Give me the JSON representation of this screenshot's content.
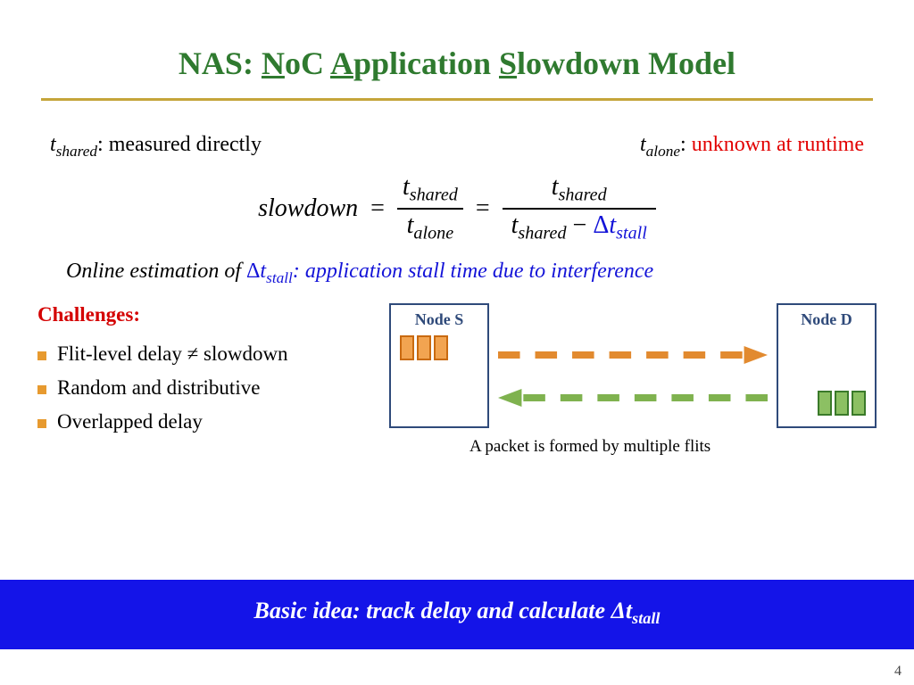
{
  "title": {
    "prefix": "NAS: ",
    "n": "N",
    "oc": "oC ",
    "a": "A",
    "pp": "pplication ",
    "s": "S",
    "rest": "lowdown Model"
  },
  "defs": {
    "left_pre": "t",
    "left_sub": "shared",
    "left_colon": ": ",
    "left_txt": "measured directly",
    "right_pre": "t",
    "right_sub": "alone",
    "right_colon": ": ",
    "right_txt": "unknown at runtime"
  },
  "eq": {
    "slowdown": "slowdown",
    "eq": "=",
    "f1_num_t": "t",
    "f1_num_sub": "shared",
    "f1_den_t": "t",
    "f1_den_sub": "alone",
    "f2_num_t": "t",
    "f2_num_sub": "shared",
    "f2_den_t1": "t",
    "f2_den_sub1": "shared",
    "minus": " − ",
    "delta": "Δ",
    "f2_den_t2": "t",
    "f2_den_sub2": "stall"
  },
  "estim": {
    "pre": "Online estimation of ",
    "delta": "Δ",
    "t": "t",
    "sub": "stall",
    "post": ": application stall time due to interference"
  },
  "challenges": {
    "heading": "Challenges:",
    "items": [
      "Flit-level delay ≠ slowdown",
      "Random and distributive",
      "Overlapped delay"
    ]
  },
  "diagram": {
    "node_s": "Node S",
    "node_d": "Node D",
    "caption": "A packet is formed by multiple flits"
  },
  "banner": {
    "pre": "Basic idea: track delay and calculate ",
    "delta": "Δ",
    "t": "t",
    "sub": "stall"
  },
  "page": "4"
}
